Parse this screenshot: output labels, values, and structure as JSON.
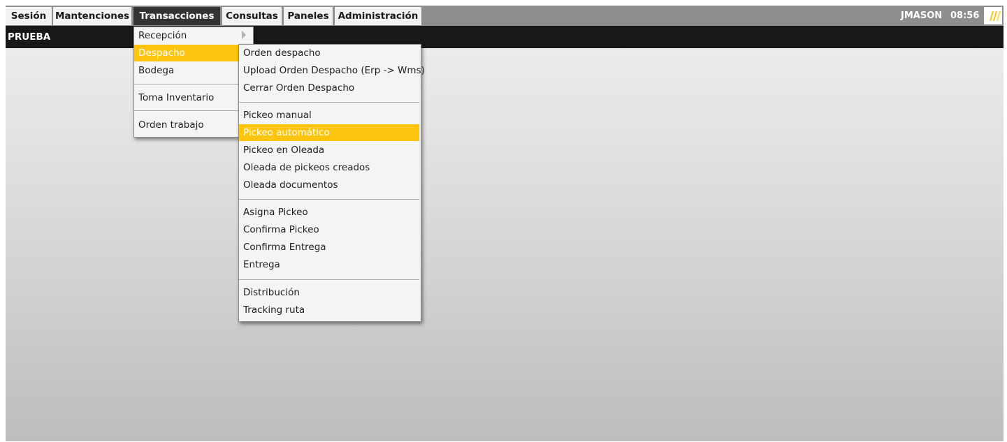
{
  "menubar": {
    "items": [
      {
        "label": "Sesión"
      },
      {
        "label": "Mantenciones"
      },
      {
        "label": "Transacciones"
      },
      {
        "label": "Consultas"
      },
      {
        "label": "Paneles"
      },
      {
        "label": "Administración"
      }
    ],
    "active_item": "Transacciones",
    "user": "JMASON",
    "time": "08:56",
    "logo_icon": "brand-slash-logo-icon",
    "colors": {
      "bar": "#8e8e8e",
      "active": "#333333",
      "accent": "#fdc50f"
    }
  },
  "subheader": {
    "title": "PRUEBA"
  },
  "transacciones_menu": {
    "items": [
      {
        "label": "Recepción"
      },
      {
        "label": "Despacho"
      },
      {
        "label": "Bodega"
      },
      {
        "label": "Toma Inventario"
      },
      {
        "label": "Orden trabajo"
      }
    ],
    "highlighted": "Despacho",
    "submenu_arrow_icon": "chevron-right-icon"
  },
  "despacho_menu": {
    "items": [
      {
        "label": "Orden despacho"
      },
      {
        "label": "Upload Orden Despacho (Erp -> Wms)"
      },
      {
        "label": "Cerrar Orden Despacho"
      },
      {
        "label": "Pickeo manual"
      },
      {
        "label": "Pickeo automático"
      },
      {
        "label": "Pickeo en Oleada"
      },
      {
        "label": "Oleada de pickeos creados"
      },
      {
        "label": "Oleada documentos"
      },
      {
        "label": "Asigna Pickeo"
      },
      {
        "label": "Confirma Pickeo"
      },
      {
        "label": "Confirma Entrega"
      },
      {
        "label": "Entrega"
      },
      {
        "label": "Distribución"
      },
      {
        "label": "Tracking ruta"
      }
    ],
    "highlighted": "Pickeo automático"
  }
}
